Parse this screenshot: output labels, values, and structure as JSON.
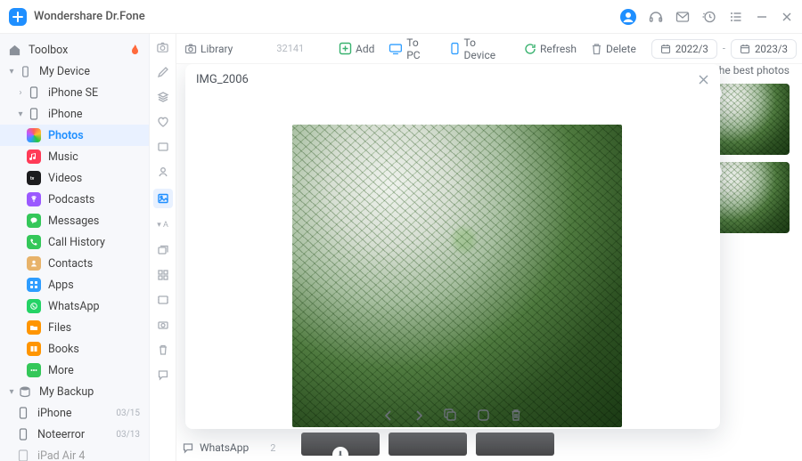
{
  "titlebar": {
    "app_name": "Wondershare Dr.Fone"
  },
  "sidebar": {
    "toolbox": "Toolbox",
    "my_device": "My Device",
    "iphone_se": "iPhone SE",
    "iphone": "iPhone",
    "items": [
      {
        "label": "Photos"
      },
      {
        "label": "Music"
      },
      {
        "label": "Videos"
      },
      {
        "label": "Podcasts"
      },
      {
        "label": "Messages"
      },
      {
        "label": "Call History"
      },
      {
        "label": "Contacts"
      },
      {
        "label": "Apps"
      },
      {
        "label": "WhatsApp"
      },
      {
        "label": "Files"
      },
      {
        "label": "Books"
      },
      {
        "label": "More"
      }
    ],
    "my_backup": "My Backup",
    "backups": [
      {
        "label": "iPhone",
        "date": "03/15"
      },
      {
        "label": "Noteerror",
        "date": "03/13"
      },
      {
        "label": "iPad Air 4",
        "date": ""
      }
    ]
  },
  "toolbar": {
    "library": "Library",
    "count": "32141",
    "add": "Add",
    "to_pc": "To PC",
    "to_device": "To Device",
    "refresh": "Refresh",
    "delete": "Delete",
    "date_from": "2022/3",
    "date_to": "2023/3"
  },
  "gallery": {
    "keep_text": "Keep the best photos",
    "sub_label": "WhatsApp",
    "sub_count": "2"
  },
  "preview": {
    "filename": "IMG_2006"
  }
}
